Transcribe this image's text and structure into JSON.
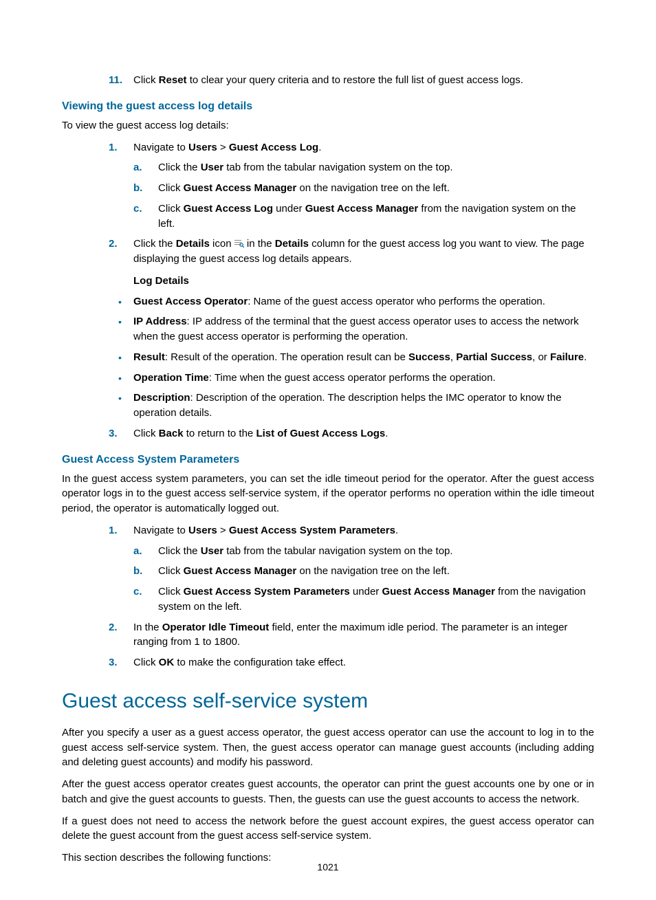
{
  "step11": {
    "num": "11.",
    "pre": "Click ",
    "b1": "Reset",
    "post": " to clear your query criteria and to restore the full list of guest access logs."
  },
  "h4_view": "Viewing the guest access log details",
  "view_intro": "To view the guest access log details:",
  "view": {
    "n1": {
      "num": "1.",
      "pre": "Navigate to ",
      "b1": "Users",
      "mid": " > ",
      "b2": "Guest Access Log",
      "post": "."
    },
    "a": {
      "mark": "a.",
      "pre": "Click the ",
      "b1": "User",
      "post": " tab from the tabular navigation system on the top."
    },
    "b": {
      "mark": "b.",
      "pre": "Click ",
      "b1": "Guest Access Manager",
      "post": " on the navigation tree on the left."
    },
    "c": {
      "mark": "c.",
      "pre": "Click ",
      "b1": "Guest Access Log",
      "mid": " under ",
      "b2": "Guest Access Manager",
      "post": " from the navigation system on the left."
    },
    "n2": {
      "num": "2.",
      "pre": "Click the ",
      "b1": "Details",
      "mid1": " icon ",
      "mid2": " in the ",
      "b2": "Details",
      "post": " column for the guest access log you want to view. The page displaying the guest access log details appears."
    },
    "logdetails": "Log Details",
    "bul1": {
      "b": "Guest Access Operator",
      "t": ": Name of the guest access operator who performs the operation."
    },
    "bul2": {
      "b": "IP Address",
      "t": ": IP address of the terminal that the guest access operator uses to access the network when the guest access operator is performing the operation."
    },
    "bul3": {
      "b": "Result",
      "t1": ": Result of the operation. The operation result can be ",
      "b1": "Success",
      "t2": ", ",
      "b2": "Partial Success",
      "t3": ", or ",
      "b3": "Failure",
      "t4": "."
    },
    "bul4": {
      "b": "Operation Time",
      "t": ": Time when the guest access operator performs the operation."
    },
    "bul5": {
      "b": "Description",
      "t": ": Description of the operation. The description helps the IMC operator to know the operation details."
    },
    "n3": {
      "num": "3.",
      "pre": "Click ",
      "b1": "Back",
      "mid": " to return to the ",
      "b2": "List of Guest Access Logs",
      "post": "."
    }
  },
  "h4_params": "Guest Access System Parameters",
  "params_intro": "In the guest access system parameters, you can set the idle timeout period for the operator. After the guest access operator logs in to the guest access self-service system, if the operator performs no operation within the idle timeout period, the operator is automatically logged out.",
  "params": {
    "n1": {
      "num": "1.",
      "pre": "Navigate to ",
      "b1": "Users",
      "mid": " > ",
      "b2": "Guest Access System Parameters",
      "post": "."
    },
    "a": {
      "mark": "a.",
      "pre": "Click the ",
      "b1": "User",
      "post": " tab from the tabular navigation system on the top."
    },
    "b": {
      "mark": "b.",
      "pre": "Click ",
      "b1": "Guest Access Manager",
      "post": " on the navigation tree on the left."
    },
    "c": {
      "mark": "c.",
      "pre": "Click ",
      "b1": "Guest Access System Parameters",
      "mid": " under ",
      "b2": "Guest Access Manager",
      "post": " from the navigation system on the left."
    },
    "n2": {
      "num": "2.",
      "pre": "In the ",
      "b1": "Operator Idle Timeout",
      "post": " field, enter the maximum idle period. The parameter is an integer ranging from 1 to 1800."
    },
    "n3": {
      "num": "3.",
      "pre": "Click ",
      "b1": "OK",
      "post": " to make the configuration take effect."
    }
  },
  "h2": "Guest access self-service system",
  "self": {
    "p1": "After you specify a user as a guest access operator, the guest access operator can use the account to log in to the guest access self-service system. Then, the guest access operator can manage guest accounts (including adding and deleting guest accounts) and modify his password.",
    "p2": "After the guest access operator creates guest accounts, the operator can print the guest accounts one by one or in batch and give the guest accounts to guests. Then, the guests can use the guest accounts to access the network.",
    "p3": "If a guest does not need to access the network before the guest account expires, the guest access operator can delete the guest account from the guest access self-service system.",
    "p4": "This section describes the following functions:"
  },
  "pageno": "1021"
}
